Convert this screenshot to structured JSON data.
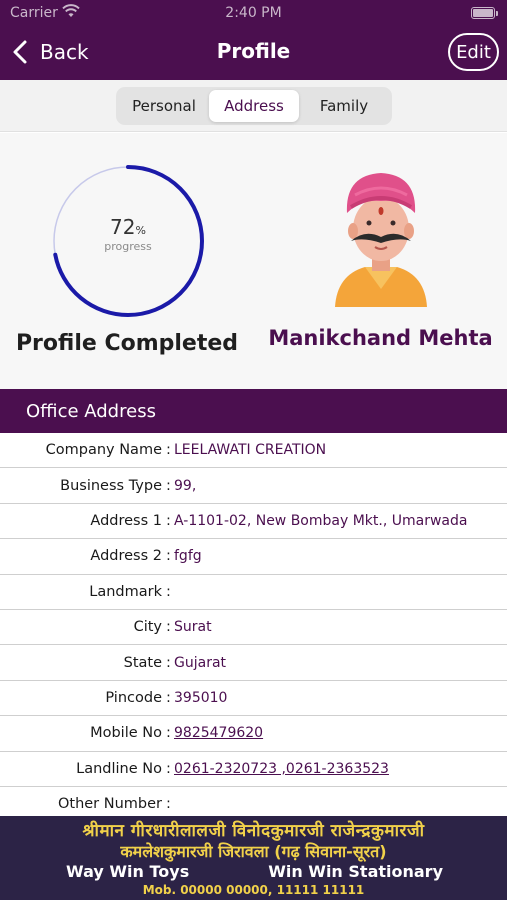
{
  "status_bar": {
    "carrier": "Carrier",
    "time": "2:40 PM"
  },
  "nav": {
    "back_label": "Back",
    "title": "Profile",
    "edit_label": "Edit"
  },
  "tabs": [
    {
      "label": "Personal",
      "active": false
    },
    {
      "label": "Address",
      "active": true
    },
    {
      "label": "Family",
      "active": false
    }
  ],
  "profile": {
    "progress_value": "72",
    "progress_unit": "%",
    "progress_fraction": 0.72,
    "progress_caption": "progress",
    "completed_label": "Profile Completed",
    "name": "Manikchand Mehta"
  },
  "section": {
    "title": "Office Address"
  },
  "fields": [
    {
      "label": "Company Name",
      "value": "LEELAWATI CREATION",
      "link": false
    },
    {
      "label": "Business Type",
      "value": "99,",
      "link": false
    },
    {
      "label": "Address 1",
      "value": "A-1101-02, New Bombay Mkt., Umarwada",
      "link": false
    },
    {
      "label": "Address 2",
      "value": "fgfg",
      "link": false
    },
    {
      "label": "Landmark",
      "value": "",
      "link": false
    },
    {
      "label": "City",
      "value": "Surat",
      "link": false
    },
    {
      "label": "State",
      "value": "Gujarat",
      "link": false
    },
    {
      "label": "Pincode",
      "value": "395010",
      "link": false
    },
    {
      "label": "Mobile No",
      "value": "9825479620",
      "link": true
    },
    {
      "label": "Landline No",
      "value": "0261-2320723 ,0261-2363523",
      "link": true
    },
    {
      "label": "Other Number",
      "value": "",
      "link": false
    }
  ],
  "banner": {
    "line1": "श्रीमान गीरधारीलालजी विनोदकुमारजी राजेन्द्रकुमारजी",
    "line2": "कमलेशकुमारजी जिरावला (गढ़ सिवाना-सूरत)",
    "left": "Way Win Toys",
    "right": "Win Win Stationary",
    "mobile": "Mob. 00000 00000, 11111 11111"
  },
  "colors": {
    "brand": "#4b0f4f",
    "progress": "#1b1aa8",
    "banner_bg": "#2c2346",
    "banner_text": "#f1d14a"
  },
  "icons": {
    "back": "chevron-left-icon",
    "wifi": "wifi-icon",
    "battery": "battery-icon",
    "avatar": "turban-man-avatar"
  }
}
